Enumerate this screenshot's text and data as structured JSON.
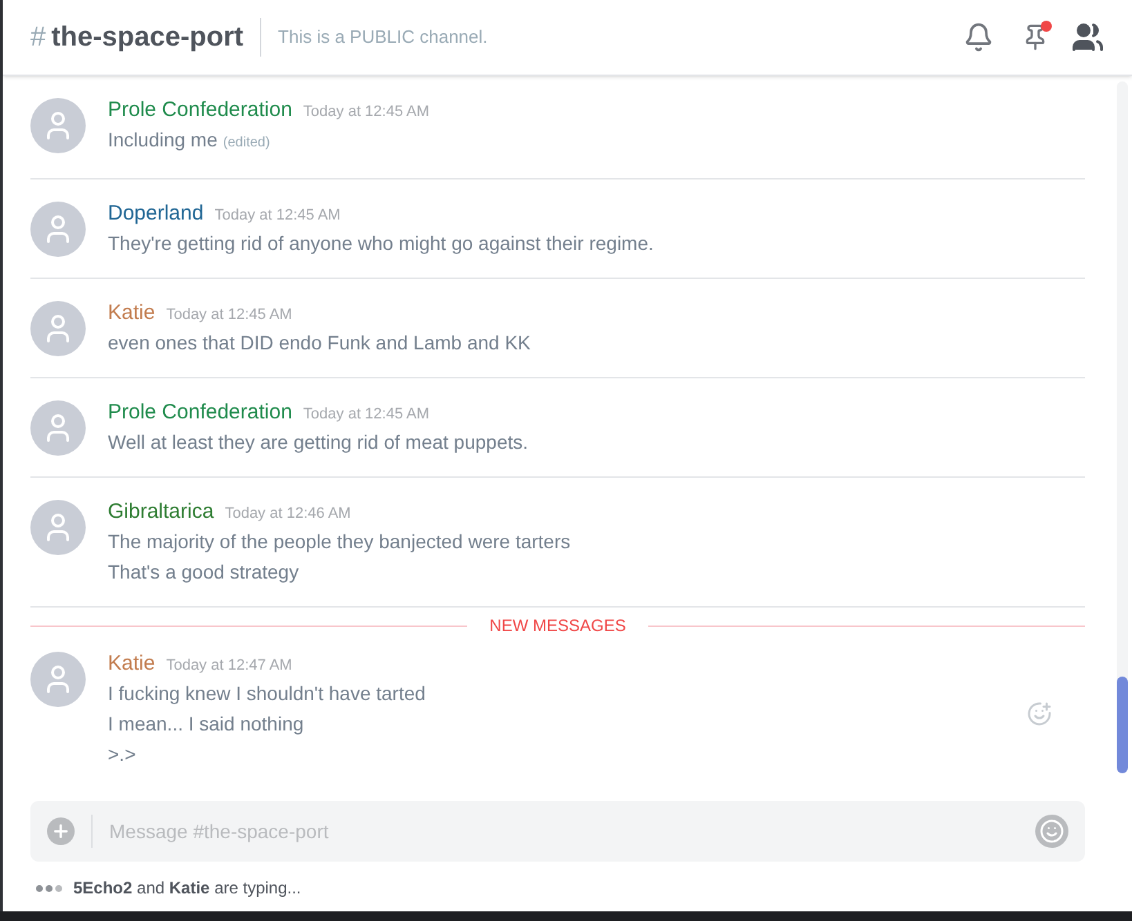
{
  "header": {
    "hash": "#",
    "channel": "the-space-port",
    "topic": "This is a PUBLIC channel."
  },
  "messages": [
    {
      "author": "Prole Confederation",
      "color": "#1f8b4c",
      "time": "Today at 12:45 AM",
      "lines": [
        "Including me"
      ],
      "edited_label": "(edited)"
    },
    {
      "author": "Doperland",
      "color": "#206694",
      "time": "Today at 12:45 AM",
      "lines": [
        "They're getting rid of anyone who might go against their regime."
      ]
    },
    {
      "author": "Katie",
      "color": "#c27c4e",
      "time": "Today at 12:45 AM",
      "lines": [
        "even ones that DID endo Funk and Lamb and KK"
      ]
    },
    {
      "author": "Prole Confederation",
      "color": "#1f8b4c",
      "time": "Today at 12:45 AM",
      "lines": [
        "Well at least they are getting rid of meat puppets."
      ]
    },
    {
      "author": "Gibraltarica",
      "color": "#2e7d32",
      "time": "Today at 12:46 AM",
      "lines": [
        "The majority of the people they banjected were tarters",
        "That's a good strategy"
      ]
    }
  ],
  "divider": "NEW MESSAGES",
  "new_messages": [
    {
      "author": "Katie",
      "color": "#c27c4e",
      "time": "Today at 12:47 AM",
      "lines": [
        "I fucking knew I shouldn't have tarted",
        "I mean... I said nothing",
        ">.>"
      ]
    }
  ],
  "composer": {
    "placeholder": "Message #the-space-port"
  },
  "typing": "**5Echo2** and **Katie** are typing..."
}
